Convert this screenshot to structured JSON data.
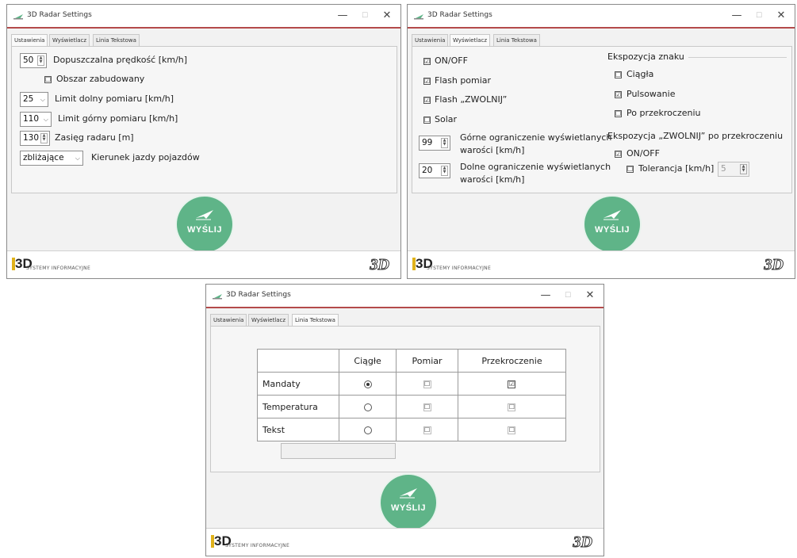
{
  "window_title": "3D Radar Settings",
  "window_controls": {
    "minimize": "—",
    "maximize": "☐",
    "close": "✕"
  },
  "tabs": [
    "Ustawienia",
    "Wyświetlacz",
    "Linia Tekstowa"
  ],
  "send_label": "WYŚLIJ",
  "footer": {
    "logo_main": "3D",
    "logo_sub": "SYSTEMY INFORMACYJNE",
    "logo_right": "3D"
  },
  "ustawienia": {
    "speed_value": "50",
    "speed_label": "Dopuszczalna prędkość [km/h]",
    "builtup_checked": "☐",
    "builtup_label": "Obszar zabudowany",
    "lower_value": "25",
    "lower_label": "Limit dolny pomiaru [km/h]",
    "upper_value": "110",
    "upper_label": "Limit górny pomiaru [km/h]",
    "range_value": "130",
    "range_label": "Zasięg radaru [m]",
    "direction_value": "zbliżające",
    "direction_label": "Kierunek jazdy pojazdów"
  },
  "wyswietlacz": {
    "onoff_label": "ON/OFF",
    "onoff_checked": "☑",
    "flash_pomiar_label": "Flash pomiar",
    "flash_pomiar_checked": "☑",
    "flash_zwolnij_label": "Flash „ZWOLNIJ”",
    "flash_zwolnij_checked": "☑",
    "solar_label": "Solar",
    "solar_checked": "☐",
    "upper_value": "99",
    "upper_label_1": "Górne ograniczenie wyświetlanych",
    "upper_label_2": "warości [km/h]",
    "lower_value": "20",
    "lower_label_1": "Dolne ograniczenie wyświetlanych",
    "lower_label_2": "warości [km/h]",
    "exposure_title": "Ekspozycja znaku",
    "ciagla_label": "Ciągła",
    "ciagla_checked": "☐",
    "pulsowanie_label": "Pulsowanie",
    "pulsowanie_checked": "☑",
    "po_przekroczeniu_label": "Po przekroczeniu",
    "po_przekroczeniu_checked": "☐",
    "zwolnij_title": "Ekspozycja „ZWOLNIJ” po przekroczeniu",
    "zwolnij_onoff_label": "ON/OFF",
    "zwolnij_onoff_checked": "☑",
    "tolerancja_label": "Tolerancja [km/h]",
    "tolerancja_checked": "☐",
    "tolerancja_value": "5"
  },
  "linia": {
    "headers": [
      "",
      "Ciągłe",
      "Pomiar",
      "Przekroczenie"
    ],
    "rows": [
      {
        "name": "Mandaty",
        "ciagle": "selected",
        "pomiar": "☐",
        "przekroczenie": "☑"
      },
      {
        "name": "Temperatura",
        "ciagle": "unselected",
        "pomiar": "☐",
        "przekroczenie": "☐"
      },
      {
        "name": "Tekst",
        "ciagle": "unselected",
        "pomiar": "☐",
        "przekroczenie": "☐"
      }
    ],
    "text_input_value": ""
  }
}
